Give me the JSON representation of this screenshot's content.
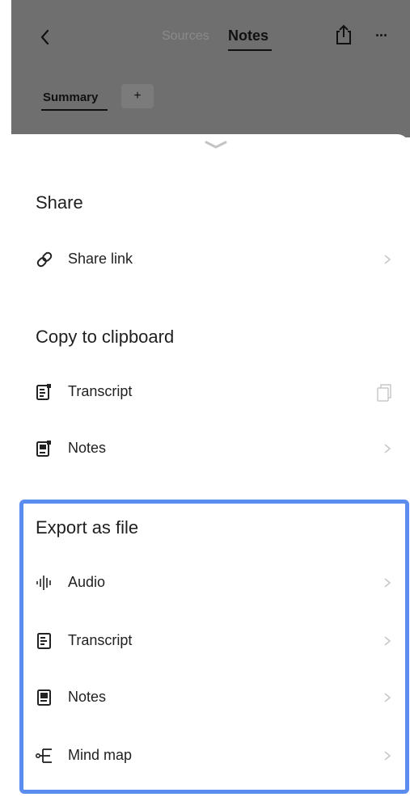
{
  "topbar": {
    "tabs": [
      {
        "label": "Sources",
        "active": false
      },
      {
        "label": "Notes",
        "active": true
      }
    ],
    "sub_tabs": [
      {
        "label": "Summary",
        "active": true
      }
    ],
    "add_label": "+",
    "more_label": "···",
    "back_icon": "chevron-left-icon",
    "share_icon": "share-icon"
  },
  "sheet": {
    "share": {
      "title": "Share",
      "items": [
        {
          "label": "Share link",
          "icon": "link-icon"
        }
      ]
    },
    "copy": {
      "title": "Copy to clipboard",
      "items": [
        {
          "label": "Transcript",
          "icon": "transcript-icon",
          "trailing": "copy-icon"
        },
        {
          "label": "Notes",
          "icon": "notes-icon",
          "trailing": "chevron-right-icon"
        }
      ]
    },
    "export": {
      "title": "Export as file",
      "items": [
        {
          "label": "Audio",
          "icon": "audio-waveform-icon"
        },
        {
          "label": "Transcript",
          "icon": "transcript-icon"
        },
        {
          "label": "Notes",
          "icon": "notes-icon"
        },
        {
          "label": "Mind map",
          "icon": "mind-map-icon"
        }
      ]
    }
  },
  "colors": {
    "overlay": "#6f6f6f",
    "highlight_border": "#5b8cf0",
    "chevron": "#c8c8c8"
  }
}
